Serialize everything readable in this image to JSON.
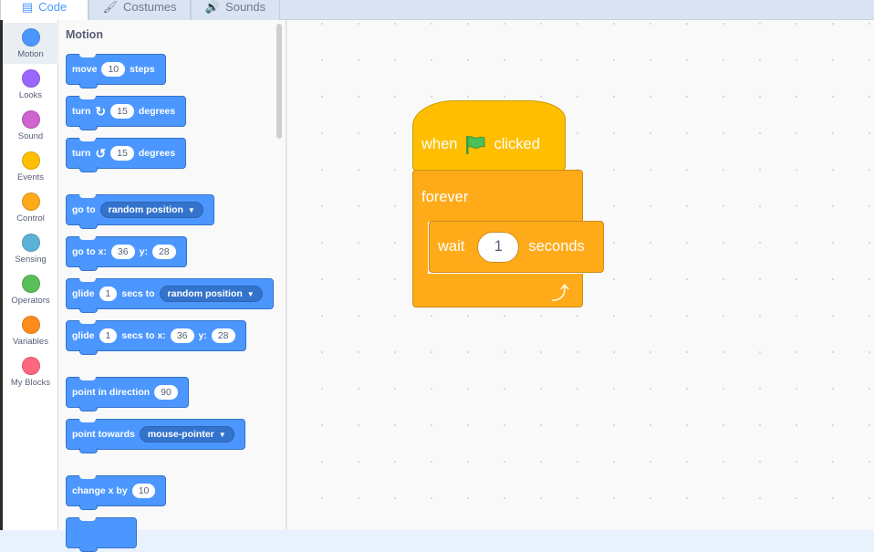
{
  "tabs": [
    {
      "label": "Code",
      "icon": "code-icon",
      "active": true
    },
    {
      "label": "Costumes",
      "icon": "brush-icon",
      "active": false
    },
    {
      "label": "Sounds",
      "icon": "speaker-icon",
      "active": false
    }
  ],
  "categories": [
    {
      "label": "Motion",
      "color": "#4c97ff"
    },
    {
      "label": "Looks",
      "color": "#9966ff"
    },
    {
      "label": "Sound",
      "color": "#cf63cf"
    },
    {
      "label": "Events",
      "color": "#ffbf00"
    },
    {
      "label": "Control",
      "color": "#ffab19"
    },
    {
      "label": "Sensing",
      "color": "#5cb1d6"
    },
    {
      "label": "Operators",
      "color": "#59c059"
    },
    {
      "label": "Variables",
      "color": "#ff8c1a"
    },
    {
      "label": "My Blocks",
      "color": "#ff6680"
    }
  ],
  "palette": {
    "title": "Motion",
    "move": {
      "text1": "move",
      "value": "10",
      "text2": "steps"
    },
    "turn_right": {
      "text1": "turn",
      "value": "15",
      "text2": "degrees"
    },
    "turn_left": {
      "text1": "turn",
      "value": "15",
      "text2": "degrees"
    },
    "goto": {
      "text1": "go to",
      "menu": "random position"
    },
    "goto_xy": {
      "text1": "go to x:",
      "x": "36",
      "text2": "y:",
      "y": "28"
    },
    "glide_to": {
      "text1": "glide",
      "secs": "1",
      "text2": "secs to",
      "menu": "random position"
    },
    "glide_xy": {
      "text1": "glide",
      "secs": "1",
      "text2": "secs to x:",
      "x": "36",
      "text3": "y:",
      "y": "28"
    },
    "point_dir": {
      "text1": "point in direction",
      "value": "90"
    },
    "point_towards": {
      "text1": "point towards",
      "menu": "mouse-pointer"
    },
    "change_x": {
      "text1": "change x by",
      "value": "10"
    }
  },
  "script": {
    "hat": {
      "text1": "when",
      "text2": "clicked"
    },
    "forever": {
      "label": "forever"
    },
    "wait": {
      "text1": "wait",
      "value": "1",
      "text2": "seconds"
    }
  }
}
